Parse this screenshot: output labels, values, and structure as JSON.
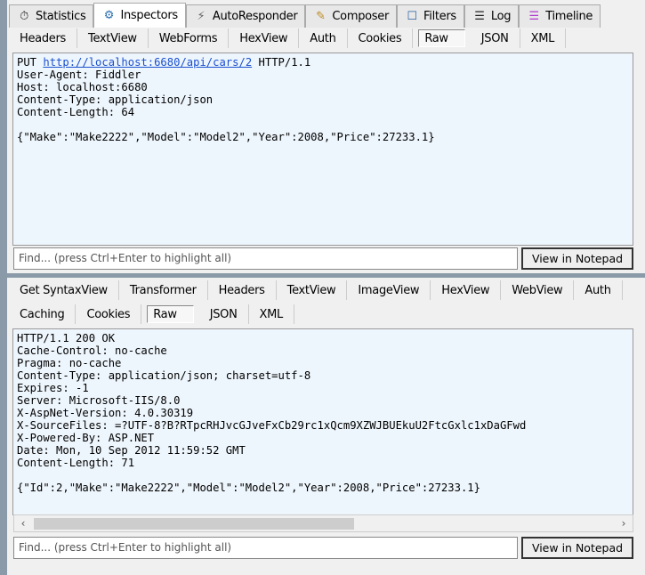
{
  "top_tabs": [
    {
      "label": "Statistics",
      "icon": "stopwatch-icon"
    },
    {
      "label": "Inspectors",
      "icon": "inspectors-icon",
      "active": true
    },
    {
      "label": "AutoResponder",
      "icon": "lightning-icon"
    },
    {
      "label": "Composer",
      "icon": "composer-icon"
    },
    {
      "label": "Filters",
      "icon": "checkbox-icon"
    },
    {
      "label": "Log",
      "icon": "log-icon"
    },
    {
      "label": "Timeline",
      "icon": "timeline-icon"
    }
  ],
  "request": {
    "tabs": [
      "Headers",
      "TextView",
      "WebForms",
      "HexView",
      "Auth",
      "Cookies",
      "Raw",
      "JSON",
      "XML"
    ],
    "selected_tab": "Raw",
    "method": "PUT",
    "url": "http://localhost:6680/api/cars/2",
    "protocol": "HTTP/1.1",
    "headers": [
      "User-Agent: Fiddler",
      "Host: localhost:6680",
      "Content-Type: application/json",
      "Content-Length: 64"
    ],
    "body": "{\"Make\":\"Make2222\",\"Model\":\"Model2\",\"Year\":2008,\"Price\":27233.1}",
    "find_placeholder": "Find... (press Ctrl+Enter to highlight all)",
    "notepad_button": "View in Notepad"
  },
  "response": {
    "tabs_row1": [
      "Get SyntaxView",
      "Transformer",
      "Headers",
      "TextView",
      "ImageView",
      "HexView",
      "WebView",
      "Auth"
    ],
    "tabs_row2": [
      "Caching",
      "Cookies",
      "Raw",
      "JSON",
      "XML"
    ],
    "selected_tab": "Raw",
    "lines": [
      "HTTP/1.1 200 OK",
      "Cache-Control: no-cache",
      "Pragma: no-cache",
      "Content-Type: application/json; charset=utf-8",
      "Expires: -1",
      "Server: Microsoft-IIS/8.0",
      "X-AspNet-Version: 4.0.30319",
      "X-SourceFiles: =?UTF-8?B?RTpcRHJvcGJveFxCb29rc1xQcm9XZWJBUEkuU2FtcGxlc1xDaGFwd",
      "X-Powered-By: ASP.NET",
      "Date: Mon, 10 Sep 2012 11:59:52 GMT",
      "Content-Length: 71"
    ],
    "body": "{\"Id\":2,\"Make\":\"Make2222\",\"Model\":\"Model2\",\"Year\":2008,\"Price\":27233.1}",
    "find_placeholder": "Find... (press Ctrl+Enter to highlight all)",
    "notepad_button": "View in Notepad"
  }
}
